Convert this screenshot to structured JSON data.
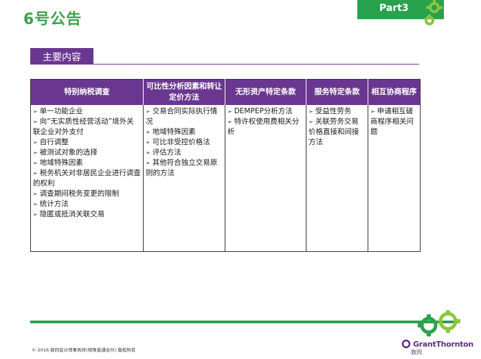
{
  "slide": {
    "title": "6号公告",
    "part_badge": "Part3",
    "section_label": "主要内容"
  },
  "table": {
    "headers": [
      "特别纳税调查",
      "可比性分析因素和转让定价方法",
      "无形资产特定条款",
      "服务特定条款",
      "相互协商程序"
    ],
    "columns": [
      [
        "单一功能企业",
        "向“无实质性经营活动”境外关联企业对外支付",
        "自行调整",
        "被测试对象的选择",
        "地域特殊因素",
        "税务机关对非居民企业进行调查的权利",
        "调查期间税务变更的限制",
        "统计方法",
        "隐匿或抵消关联交易"
      ],
      [
        "交易合同实际执行情况",
        "地域特殊因素",
        "可比非受控价格法",
        "评估方法",
        "其他符合独立交易原则的方法"
      ],
      [
        "DEMPEP分析方法",
        "特许权使用费相关分析"
      ],
      [
        "受益性劳务",
        "关联劳务交易价格直接和间接方法"
      ],
      [
        "申请相互磋商程序相关问题"
      ]
    ]
  },
  "footer": {
    "copyright": "© 2016 致同会计师事务所(特殊普通合伙) 版权所有",
    "brand_name": "GrantThornton",
    "brand_sub": "致同"
  },
  "colors": {
    "green": "#29a24d",
    "purple": "#6a3790"
  }
}
